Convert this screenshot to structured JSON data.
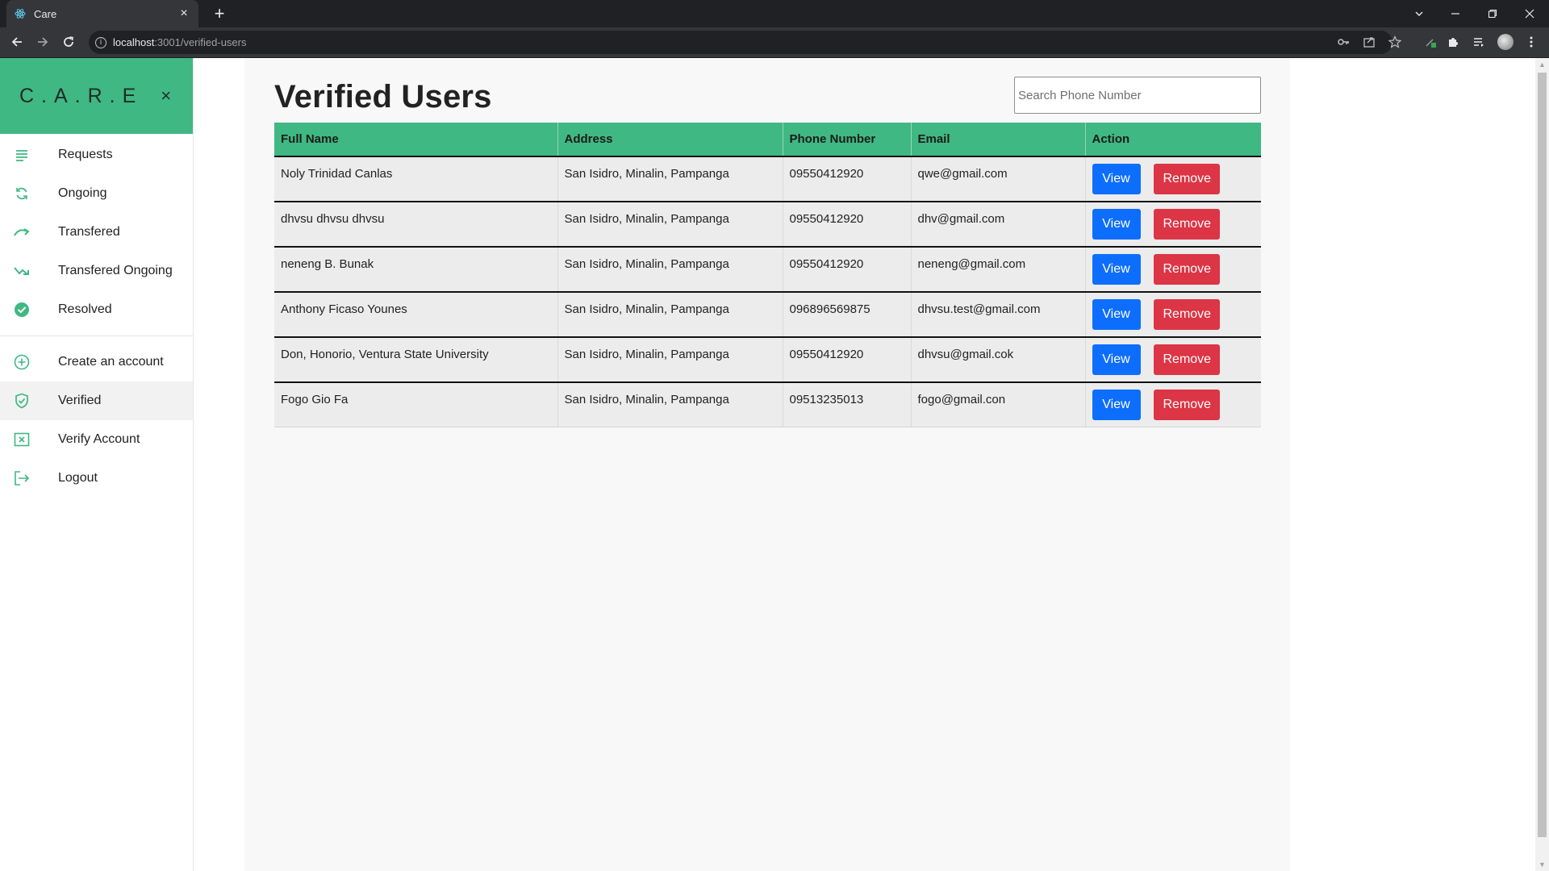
{
  "browser": {
    "tab_title": "Care",
    "tab_close": "×",
    "new_tab": "+",
    "url_host": "localhost",
    "url_rest": ":3001/verified-users"
  },
  "sidebar": {
    "brand": "C.A.R.E",
    "brand_close": "×",
    "items": [
      {
        "label": "Requests",
        "icon": "list-lines-icon"
      },
      {
        "label": "Ongoing",
        "icon": "refresh-icon"
      },
      {
        "label": "Transfered",
        "icon": "trend-up-icon"
      },
      {
        "label": "Transfered Ongoing",
        "icon": "trend-down-icon"
      },
      {
        "label": "Resolved",
        "icon": "check-circle-icon"
      },
      {
        "label": "Create an account",
        "icon": "plus-circle-icon"
      },
      {
        "label": "Verified",
        "icon": "shield-check-icon"
      },
      {
        "label": "Verify Account",
        "icon": "x-box-icon"
      },
      {
        "label": "Logout",
        "icon": "logout-icon"
      }
    ],
    "active": "Verified"
  },
  "main": {
    "title": "Verified Users",
    "search": {
      "placeholder": "Search Phone Number",
      "value": ""
    },
    "table": {
      "headers": [
        "Full Name",
        "Address",
        "Phone Number",
        "Email",
        "Action"
      ],
      "rows": [
        {
          "name": "Noly Trinidad Canlas",
          "address": "San Isidro, Minalin, Pampanga",
          "phone": "09550412920",
          "email": "qwe@gmail.com"
        },
        {
          "name": "dhvsu dhvsu dhvsu",
          "address": "San Isidro, Minalin, Pampanga",
          "phone": "09550412920",
          "email": "dhv@gmail.com"
        },
        {
          "name": "neneng B. Bunak",
          "address": "San Isidro, Minalin, Pampanga",
          "phone": "09550412920",
          "email": "neneng@gmail.com"
        },
        {
          "name": "Anthony Ficaso Younes",
          "address": "San Isidro, Minalin, Pampanga",
          "phone": "096896569875",
          "email": "dhvsu.test@gmail.com"
        },
        {
          "name": "Don, Honorio, Ventura State University",
          "address": "San Isidro, Minalin, Pampanga",
          "phone": "09550412920",
          "email": "dhvsu@gmail.cok"
        },
        {
          "name": "Fogo Gio Fa",
          "address": "San Isidro, Minalin, Pampanga",
          "phone": "09513235013",
          "email": "fogo@gmail.con"
        }
      ],
      "view_label": "View",
      "remove_label": "Remove"
    }
  },
  "colors": {
    "brand_green": "#40b883",
    "view_blue": "#0d6efd",
    "remove_red": "#dc3545"
  }
}
